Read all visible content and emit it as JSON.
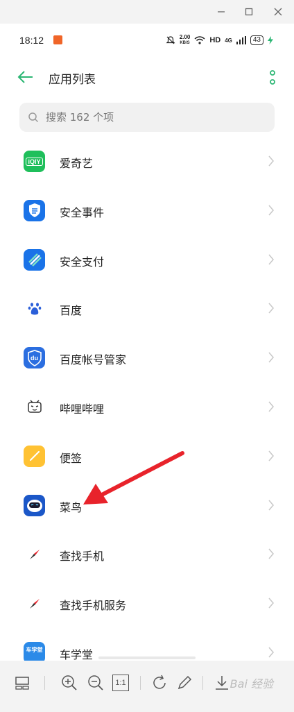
{
  "status": {
    "time": "18:12",
    "speed_top": "2.00",
    "speed_unit": "KB/S",
    "hd": "HD",
    "signal": "4G",
    "battery": "43"
  },
  "header": {
    "title": "应用列表"
  },
  "search": {
    "placeholder": "搜索 162 个项"
  },
  "apps": [
    {
      "label": "爱奇艺"
    },
    {
      "label": "安全事件"
    },
    {
      "label": "安全支付"
    },
    {
      "label": "百度"
    },
    {
      "label": "百度帐号管家"
    },
    {
      "label": "哔哩哔哩"
    },
    {
      "label": "便签"
    },
    {
      "label": "菜鸟"
    },
    {
      "label": "查找手机"
    },
    {
      "label": "查找手机服务"
    },
    {
      "label": "车学堂"
    }
  ],
  "icons": {
    "iqiyi_text": "iQIY",
    "baidu_text": "du",
    "chexuetang_text": "车学堂"
  },
  "toolbar": {
    "one_to_one": "1:1",
    "watermark": "Bai 经验"
  },
  "colors": {
    "accent": "#2bb673",
    "iqiyi": "#1fbf5b",
    "security_blue": "#1a73e8",
    "note_yellow": "#ffc233",
    "arrow_red": "#e8232b"
  }
}
